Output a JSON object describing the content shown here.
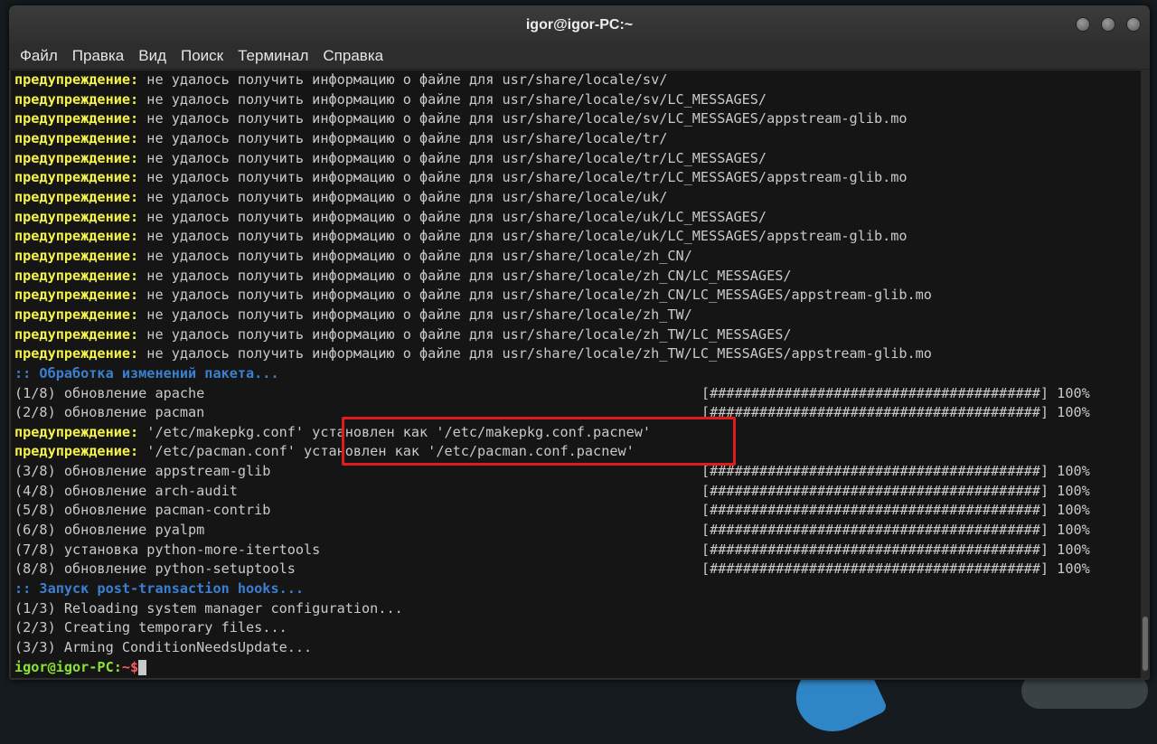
{
  "window": {
    "title": "igor@igor-PC:~"
  },
  "menu": [
    "Файл",
    "Правка",
    "Вид",
    "Поиск",
    "Терминал",
    "Справка"
  ],
  "warn_label": "предупреждение:",
  "warn_msg_prefix": " не удалось получить информацию о файле для ",
  "warn_paths": [
    "usr/share/locale/sv/",
    "usr/share/locale/sv/LC_MESSAGES/",
    "usr/share/locale/sv/LC_MESSAGES/appstream-glib.mo",
    "usr/share/locale/tr/",
    "usr/share/locale/tr/LC_MESSAGES/",
    "usr/share/locale/tr/LC_MESSAGES/appstream-glib.mo",
    "usr/share/locale/uk/",
    "usr/share/locale/uk/LC_MESSAGES/",
    "usr/share/locale/uk/LC_MESSAGES/appstream-glib.mo",
    "usr/share/locale/zh_CN/",
    "usr/share/locale/zh_CN/LC_MESSAGES/",
    "usr/share/locale/zh_CN/LC_MESSAGES/appstream-glib.mo",
    "usr/share/locale/zh_TW/",
    "usr/share/locale/zh_TW/LC_MESSAGES/",
    "usr/share/locale/zh_TW/LC_MESSAGES/appstream-glib.mo"
  ],
  "section1": ":: Обработка изменений пакета...",
  "progress_bar": "[########################################] 100%",
  "steps_before": [
    "(1/8) обновление apache",
    "(2/8) обновление pacman"
  ],
  "pacnew": [
    " '/etc/makepkg.conf' установлен как '/etc/makepkg.conf.pacnew'",
    " '/etc/pacman.conf' установлен как '/etc/pacman.conf.pacnew'"
  ],
  "steps_after": [
    "(3/8) обновление appstream-glib",
    "(4/8) обновление arch-audit",
    "(5/8) обновление pacman-contrib",
    "(6/8) обновление pyalpm",
    "(7/8) установка python-more-itertools",
    "(8/8) обновление python-setuptools"
  ],
  "section2": ":: Запуск post-transaction hooks...",
  "hooks": [
    "(1/3) Reloading system manager configuration...",
    "(2/3) Creating temporary files...",
    "(3/3) Arming ConditionNeedsUpdate..."
  ],
  "prompt": {
    "user": "igor@igor-PC:",
    "path": "~$"
  },
  "colors": {
    "warning": "#f5f34a",
    "section": "#3b7fd1",
    "prompt_user": "#8ae234",
    "prompt_path": "#ff5a5a",
    "highlight": "#e01b1b"
  }
}
